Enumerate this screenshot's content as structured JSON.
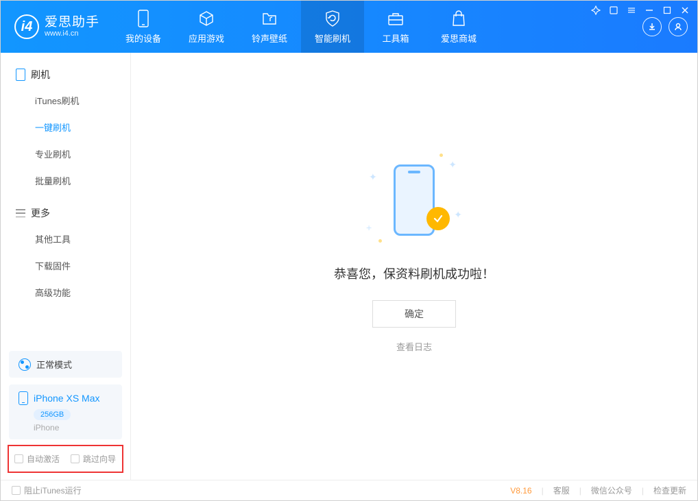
{
  "app": {
    "title": "爱思助手",
    "subtitle": "www.i4.cn"
  },
  "nav": {
    "items": [
      {
        "label": "我的设备"
      },
      {
        "label": "应用游戏"
      },
      {
        "label": "铃声壁纸"
      },
      {
        "label": "智能刷机"
      },
      {
        "label": "工具箱"
      },
      {
        "label": "爱思商城"
      }
    ]
  },
  "sidebar": {
    "section_flash": "刷机",
    "flash_items": [
      {
        "label": "iTunes刷机"
      },
      {
        "label": "一键刷机"
      },
      {
        "label": "专业刷机"
      },
      {
        "label": "批量刷机"
      }
    ],
    "section_more": "更多",
    "more_items": [
      {
        "label": "其他工具"
      },
      {
        "label": "下载固件"
      },
      {
        "label": "高级功能"
      }
    ],
    "mode": "正常模式",
    "device": {
      "name": "iPhone XS Max",
      "storage": "256GB",
      "type": "iPhone"
    },
    "checkbox_auto_activate": "自动激活",
    "checkbox_skip_wizard": "跳过向导"
  },
  "main": {
    "success_message": "恭喜您，保资料刷机成功啦！",
    "ok_button": "确定",
    "view_log": "查看日志"
  },
  "footer": {
    "block_itunes": "阻止iTunes运行",
    "version": "V8.16",
    "support": "客服",
    "wechat": "微信公众号",
    "check_update": "检查更新"
  }
}
